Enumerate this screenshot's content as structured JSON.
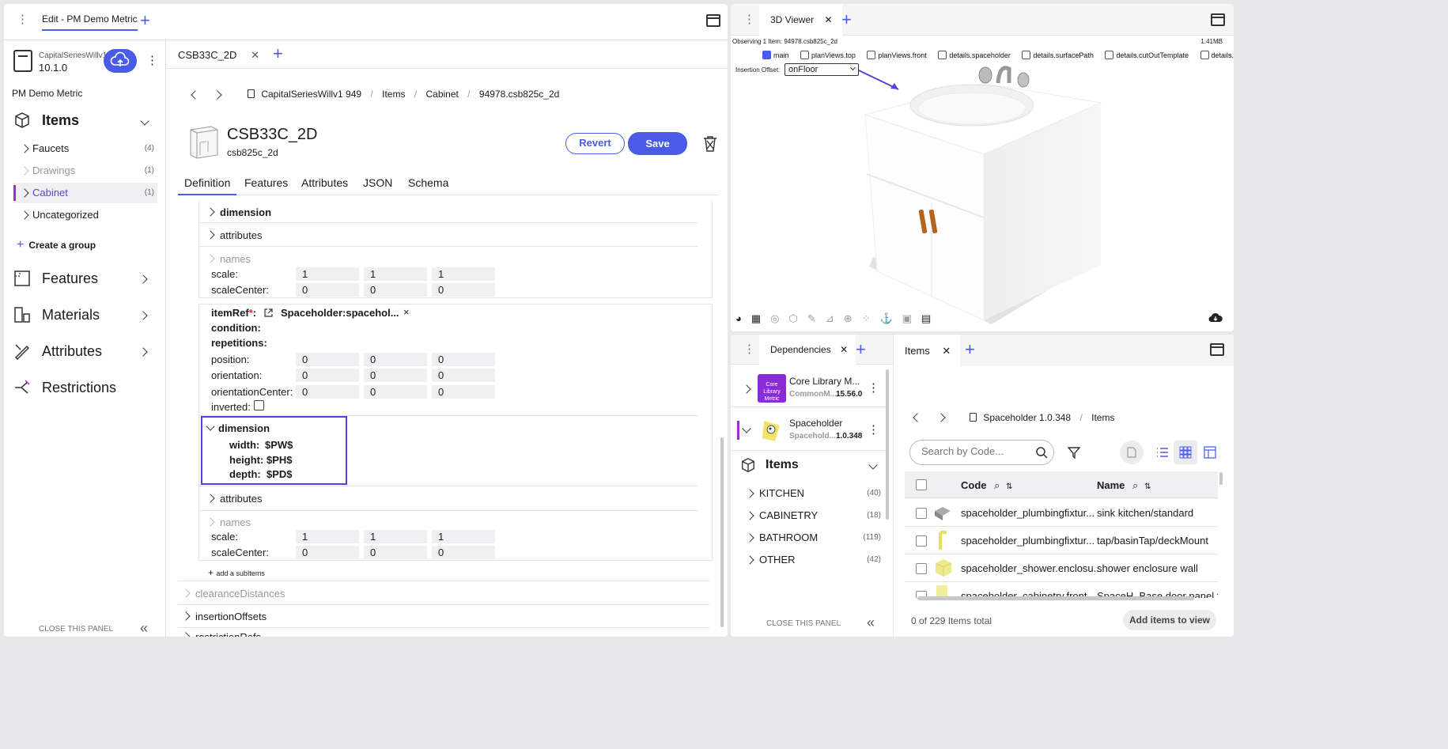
{
  "left_window": {
    "tab_title": "Edit - PM Demo Metric",
    "project": {
      "name": "CapitalSeriesWillv1",
      "version": "10.1.0",
      "label": "PM Demo Metric"
    },
    "sidebar": {
      "items_header": "Items",
      "groups": [
        {
          "label": "Faucets",
          "count": "(4)"
        },
        {
          "label": "Drawings",
          "count": "(1)"
        },
        {
          "label": "Cabinet",
          "count": "(1)"
        },
        {
          "label": "Uncategorized",
          "count": ""
        }
      ],
      "create_group": "Create a group",
      "sections": [
        "Features",
        "Materials",
        "Attributes",
        "Restrictions"
      ],
      "close_panel": "CLOSE THIS PANEL"
    },
    "editor": {
      "doc_tab": "CSB33C_2D",
      "breadcrumb": [
        "CapitalSeriesWillv1 949",
        "Items",
        "Cabinet",
        "94978.csb825c_2d"
      ],
      "title": "CSB33C_2D",
      "subtitle": "csb825c_2d",
      "revert": "Revert",
      "save": "Save",
      "tabs": [
        "Definition",
        "Features",
        "Attributes",
        "JSON",
        "Schema"
      ],
      "block1": {
        "dimension": "dimension",
        "attributes": "attributes",
        "names": "names",
        "scale_label": "scale:",
        "scale": [
          "1",
          "1",
          "1"
        ],
        "scale_center_label": "scaleCenter:",
        "scale_center": [
          "0",
          "0",
          "0"
        ]
      },
      "block2": {
        "item_ref_label": "itemRef",
        "required_mark": "*",
        "item_ref_colon": ":",
        "item_ref_value": "Spaceholder:spacehol...",
        "remove_mark": "×",
        "condition": "condition:",
        "repetitions": "repetitions:",
        "position_label": "position:",
        "position": [
          "0",
          "0",
          "0"
        ],
        "orientation_label": "orientation:",
        "orientation": [
          "0",
          "0",
          "0"
        ],
        "orientation_center_label": "orientationCenter:",
        "orientation_center": [
          "0",
          "0",
          "0"
        ],
        "inverted": "inverted:",
        "dimension": "dimension",
        "width_label": "width:",
        "width": "$PW$",
        "height_label": "height:",
        "height": "$PH$",
        "depth_label": "depth:",
        "depth": "$PD$",
        "attributes": "attributes",
        "names": "names",
        "scale_label": "scale:",
        "scale": [
          "1",
          "1",
          "1"
        ],
        "scale_center_label": "scaleCenter:",
        "scale_center": [
          "0",
          "0",
          "0"
        ]
      },
      "add_subitems": "add a subItems",
      "bottom_rows": [
        "clearanceDistances",
        "insertionOffsets",
        "restrictionRefs"
      ]
    }
  },
  "viewer": {
    "tab_title": "3D Viewer",
    "observing": "Observing 1 Item: 94978.csb825c_2d",
    "size": "1.41MB",
    "checks": [
      {
        "label": "main",
        "checked": true
      },
      {
        "label": "planViews.top",
        "checked": false
      },
      {
        "label": "planViews.front",
        "checked": false
      },
      {
        "label": "details.spaceholder",
        "checked": false
      },
      {
        "label": "details.surfacePath",
        "checked": false
      },
      {
        "label": "details.cutOutTemplate",
        "checked": false
      },
      {
        "label": "details.bottomLinearPath",
        "checked": false
      }
    ],
    "insertion_offset_label": "Insertion Offset:",
    "insertion_offset_value": "onFloor"
  },
  "dependencies": {
    "tab_title": "Dependencies",
    "libs": [
      {
        "name": "Core Library M...",
        "sub": "CommonM...",
        "version": "15.56.0",
        "thumb_text": "Core Library Metric"
      },
      {
        "name": "Spaceholder",
        "sub": "Spacehold...",
        "version": "1.0.348"
      }
    ],
    "items_header": "Items",
    "groups": [
      {
        "label": "KITCHEN",
        "count": "(40)"
      },
      {
        "label": "CABINETRY",
        "count": "(18)"
      },
      {
        "label": "BATHROOM",
        "count": "(119)"
      },
      {
        "label": "OTHER",
        "count": "(42)"
      }
    ],
    "close_panel": "CLOSE THIS PANEL"
  },
  "items_panel": {
    "tab_title": "Items",
    "breadcrumb": [
      "Spaceholder 1.0.348",
      "Items"
    ],
    "search_placeholder": "Search by Code...",
    "columns": [
      "Code",
      "Name"
    ],
    "rows": [
      {
        "code": "spaceholder_plumbingfixtur...",
        "name": "sink kitchen/standard"
      },
      {
        "code": "spaceholder_plumbingfixtur...",
        "name": "tap/basinTap/deckMount"
      },
      {
        "code": "spaceholder_shower.enclosu...",
        "name": "shower enclosure wall"
      },
      {
        "code": "spaceholder_cabinetry.front...",
        "name": "SpaceH. Base door panel for"
      }
    ],
    "total": "0 of 229 Items total",
    "add_button": "Add items to view"
  },
  "colors": {
    "accent": "#4a5be8",
    "highlight_box": "#5a3fd8",
    "active_marker": "#9b2fc9"
  }
}
